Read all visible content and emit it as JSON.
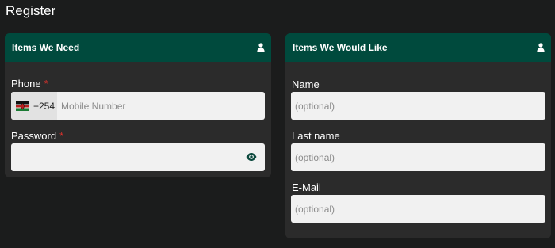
{
  "page": {
    "title": "Register"
  },
  "colors": {
    "background": "#1b1c1c",
    "card": "#2b2b2b",
    "header": "#004a3d",
    "input": "#f1f1f1",
    "required": "#e0322c",
    "accent_icon": "#0d4a3f"
  },
  "left_card": {
    "title": "Items We Need",
    "icon": "user-icon",
    "phone": {
      "label": "Phone",
      "required_mark": "*",
      "flag_icon": "kenya-flag-icon",
      "dial_code": "+254",
      "placeholder": "Mobile Number",
      "value": ""
    },
    "password": {
      "label": "Password",
      "required_mark": "*",
      "value": "",
      "toggle_icon": "eye-icon"
    }
  },
  "right_card": {
    "title": "Items We Would Like",
    "icon": "user-icon",
    "name": {
      "label": "Name",
      "placeholder": "(optional)",
      "value": ""
    },
    "last_name": {
      "label": "Last name",
      "placeholder": "(optional)",
      "value": ""
    },
    "email": {
      "label": "E-Mail",
      "placeholder": "(optional)",
      "value": ""
    }
  }
}
